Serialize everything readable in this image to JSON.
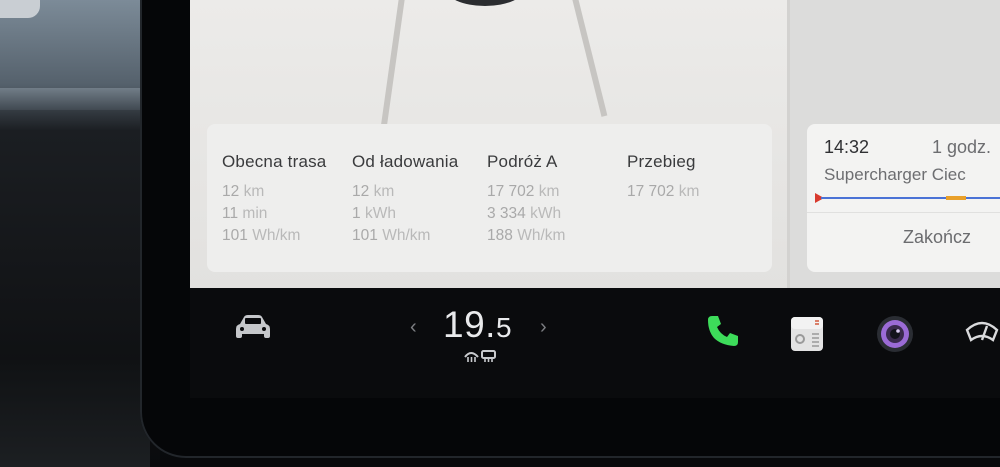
{
  "trip": {
    "columns": [
      {
        "header": "Obecna trasa",
        "rows": [
          {
            "value": "12",
            "unit": "km"
          },
          {
            "value": "11",
            "unit": "min"
          },
          {
            "value": "101",
            "unit": "Wh/km"
          }
        ]
      },
      {
        "header": "Od ładowania",
        "rows": [
          {
            "value": "12",
            "unit": "km"
          },
          {
            "value": "1",
            "unit": "kWh"
          },
          {
            "value": "101",
            "unit": "Wh/km"
          }
        ]
      },
      {
        "header": "Podróż A",
        "rows": [
          {
            "value": "17 702",
            "unit": "km"
          },
          {
            "value": "3 334",
            "unit": "kWh"
          },
          {
            "value": "188",
            "unit": "Wh/km"
          }
        ]
      },
      {
        "header": "Przebieg",
        "rows": [
          {
            "value": "17 702",
            "unit": "km"
          }
        ]
      }
    ]
  },
  "navigation": {
    "arrival_time": "14:32",
    "duration": "1 godz.",
    "destination": "Supercharger Ciec",
    "end_button": "Zakończ"
  },
  "bottom_bar": {
    "temperature_int": "19.",
    "temperature_dec": "5",
    "chevron_left": "‹",
    "chevron_right": "›",
    "icons": [
      "car-icon",
      "defrost-icon",
      "phone-icon",
      "toybox-icon",
      "camera-icon",
      "wiper-icon"
    ],
    "colors": {
      "phone": "#3ddc5a",
      "camera_ring": "#9b6bd6"
    }
  }
}
